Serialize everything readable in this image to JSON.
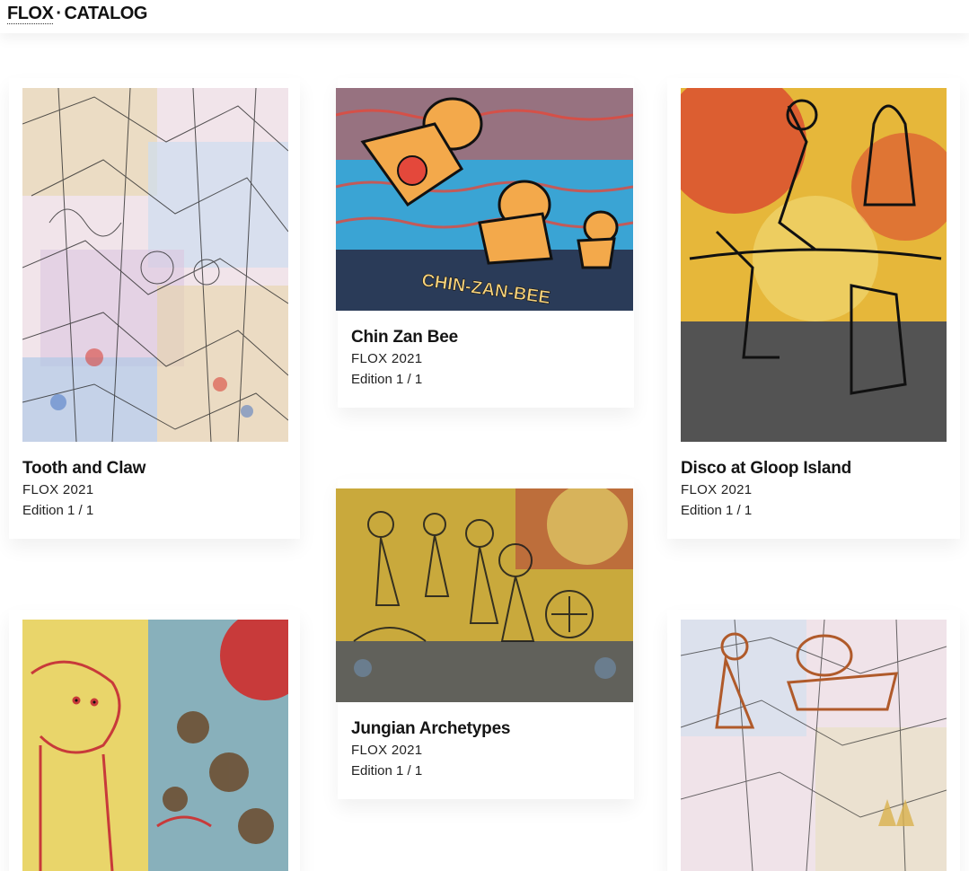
{
  "header": {
    "brand": "FLOX",
    "separator": "·",
    "section": "CATALOG"
  },
  "artworks": [
    {
      "title": "Tooth and Claw",
      "artist": "FLOX 2021",
      "edition": "Edition 1 / 1",
      "palette": [
        "#efe3ea",
        "#c7d9ee",
        "#e8d7a6",
        "#d9a6b6",
        "#9fc0df"
      ]
    },
    {
      "title": "Chin Zan Bee",
      "artist": "FLOX 2021",
      "edition": "Edition 1 / 1",
      "image_text": "CHIN-ZAN-BEE",
      "palette": [
        "#f3a94b",
        "#3aa6d6",
        "#2a3b58",
        "#e4483b",
        "#f6d27c"
      ]
    },
    {
      "title": "Disco at Gloop Island",
      "artist": "FLOX 2021",
      "edition": "Edition 1 / 1",
      "palette": [
        "#e6b73a",
        "#d8402f",
        "#2e3a5a",
        "#f2dc7a",
        "#8a7a3a"
      ]
    },
    {
      "title": "Jungian Archetypes",
      "artist": "FLOX 2021",
      "edition": "Edition 1 / 1",
      "palette": [
        "#c9a93c",
        "#3d4a66",
        "#e2d06a",
        "#b5483a",
        "#6f8fb0"
      ]
    },
    {
      "title": "",
      "artist": "",
      "edition": "",
      "palette": [
        "#e9d56a",
        "#6fa6cf",
        "#c83a3a",
        "#6b4a2b",
        "#f2e6b6"
      ]
    },
    {
      "title": "",
      "artist": "",
      "edition": "",
      "palette": [
        "#f0e3e9",
        "#cfe0f0",
        "#d9b24e",
        "#b5a0c8",
        "#e8e0c4"
      ]
    }
  ]
}
